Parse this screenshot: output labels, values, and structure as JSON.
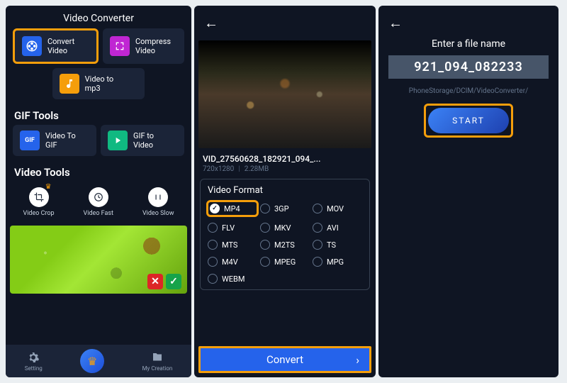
{
  "panel1": {
    "title": "Video Converter",
    "cards": {
      "convert": "Convert\nVideo",
      "compress": "Compress\nVideo",
      "mp3": "Video to\nmp3"
    },
    "gif_heading": "GIF Tools",
    "gif_cards": {
      "to_gif": "Video To\nGIF",
      "to_video": "GIF to\nVideo"
    },
    "video_heading": "Video Tools",
    "tools": {
      "crop": "Video Crop",
      "fast": "Video Fast",
      "slow": "Video Slow"
    },
    "bottom": {
      "setting": "Setting",
      "creation": "My Creation"
    }
  },
  "panel2": {
    "video_name": "VID_27560628_182921_094_...",
    "resolution": "720x1280",
    "size": "2.28MB",
    "format_title": "Video Format",
    "formats": [
      "MP4",
      "3GP",
      "MOV",
      "FLV",
      "MKV",
      "AVI",
      "MTS",
      "M2TS",
      "TS",
      "M4V",
      "MPEG",
      "MPG",
      "WEBM"
    ],
    "selected": "MP4",
    "convert_label": "Convert"
  },
  "panel3": {
    "title": "Enter a file name",
    "filename": "921_094_082233",
    "path": "PhoneStorage/DCIM/VideoConverter/",
    "start_label": "START"
  }
}
